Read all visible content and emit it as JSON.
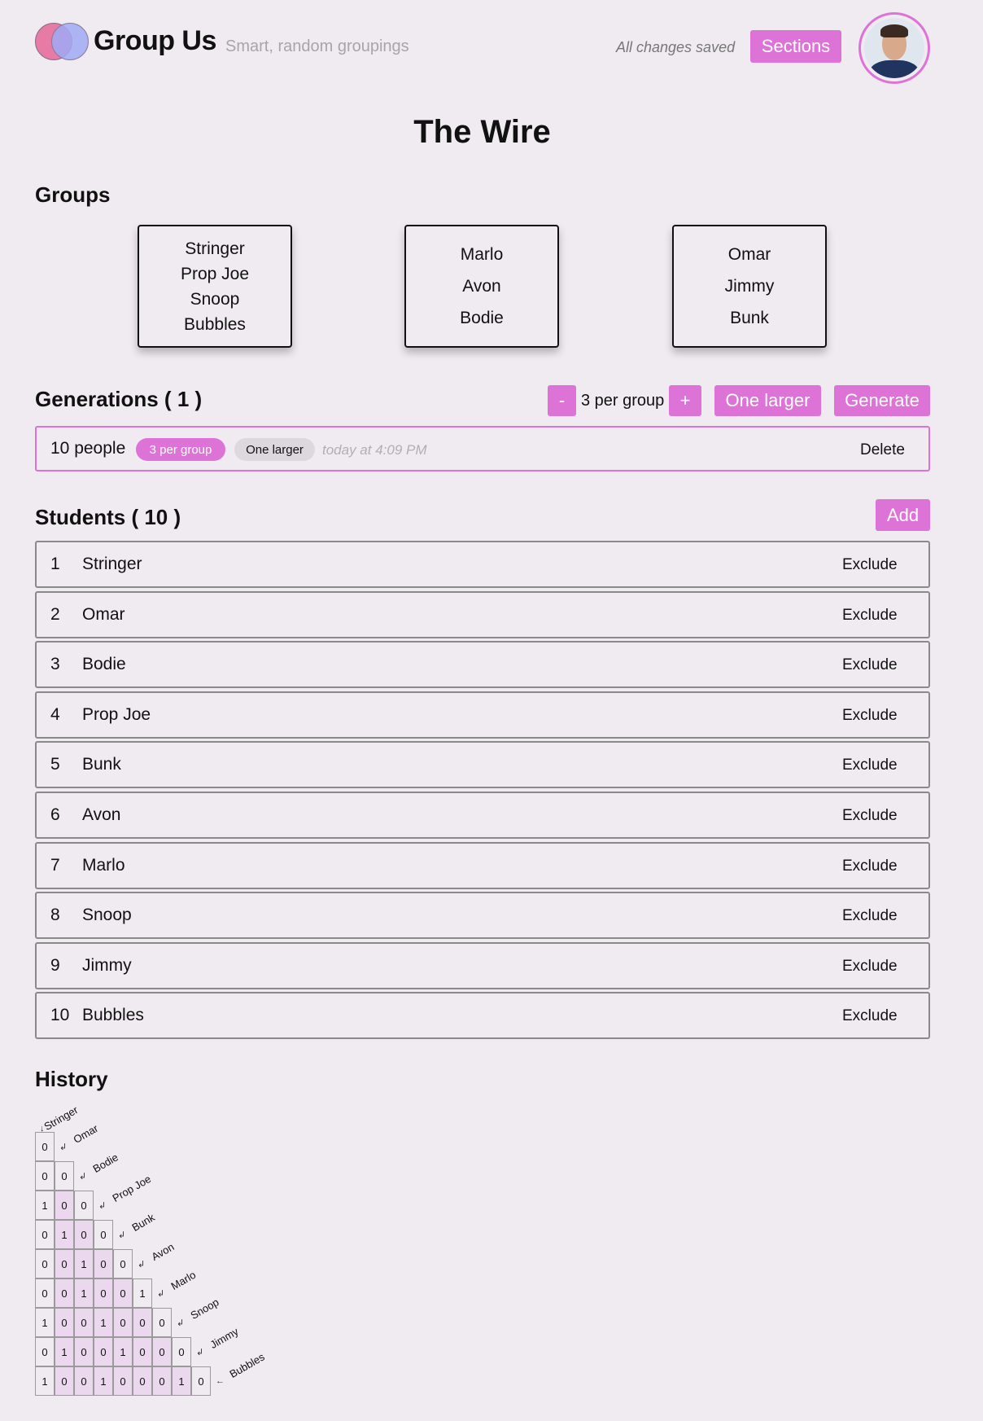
{
  "header": {
    "app_title": "Group Us",
    "subtitle": "Smart, random groupings",
    "save_status": "All changes saved",
    "sections_label": "Sections"
  },
  "page_title": "The Wire",
  "groups": {
    "heading": "Groups",
    "cards": [
      [
        "Stringer",
        "Prop Joe",
        "Snoop",
        "Bubbles"
      ],
      [
        "Marlo",
        "Avon",
        "Bodie"
      ],
      [
        "Omar",
        "Jimmy",
        "Bunk"
      ]
    ]
  },
  "generations": {
    "heading": "Generations ( 1 )",
    "minus_label": "-",
    "per_group_label": "3 per group",
    "plus_label": "+",
    "one_larger_label": "One larger",
    "generate_label": "Generate",
    "entry": {
      "people": "10 people",
      "per_group_badge": "3 per group",
      "one_larger_badge": "One larger",
      "time": "today at 4:09 PM",
      "delete_label": "Delete"
    }
  },
  "students": {
    "heading": "Students ( 10 )",
    "add_label": "Add",
    "exclude_label": "Exclude",
    "list": [
      {
        "num": "1",
        "name": "Stringer"
      },
      {
        "num": "2",
        "name": "Omar"
      },
      {
        "num": "3",
        "name": "Bodie"
      },
      {
        "num": "4",
        "name": "Prop Joe"
      },
      {
        "num": "5",
        "name": "Bunk"
      },
      {
        "num": "6",
        "name": "Avon"
      },
      {
        "num": "7",
        "name": "Marlo"
      },
      {
        "num": "8",
        "name": "Snoop"
      },
      {
        "num": "9",
        "name": "Jimmy"
      },
      {
        "num": "10",
        "name": "Bubbles"
      }
    ]
  },
  "history": {
    "heading": "History",
    "names": [
      "Stringer",
      "Omar",
      "Bodie",
      "Prop Joe",
      "Bunk",
      "Avon",
      "Marlo",
      "Snoop",
      "Jimmy",
      "Bubbles"
    ],
    "matrix": [
      [
        "0"
      ],
      [
        "0",
        "0"
      ],
      [
        "1",
        "0",
        "0"
      ],
      [
        "0",
        "1",
        "0",
        "0"
      ],
      [
        "0",
        "0",
        "1",
        "0",
        "0"
      ],
      [
        "0",
        "0",
        "1",
        "0",
        "0",
        "1"
      ],
      [
        "1",
        "0",
        "0",
        "1",
        "0",
        "0",
        "0"
      ],
      [
        "0",
        "1",
        "0",
        "0",
        "1",
        "0",
        "0",
        "0"
      ],
      [
        "1",
        "0",
        "0",
        "1",
        "0",
        "0",
        "0",
        "1",
        "0"
      ]
    ]
  },
  "colors": {
    "accent": "#dd73d7",
    "background": "#f0ebf1"
  },
  "icons": {
    "logo": "overlapping-circles-logo",
    "avatar": "user-avatar"
  }
}
